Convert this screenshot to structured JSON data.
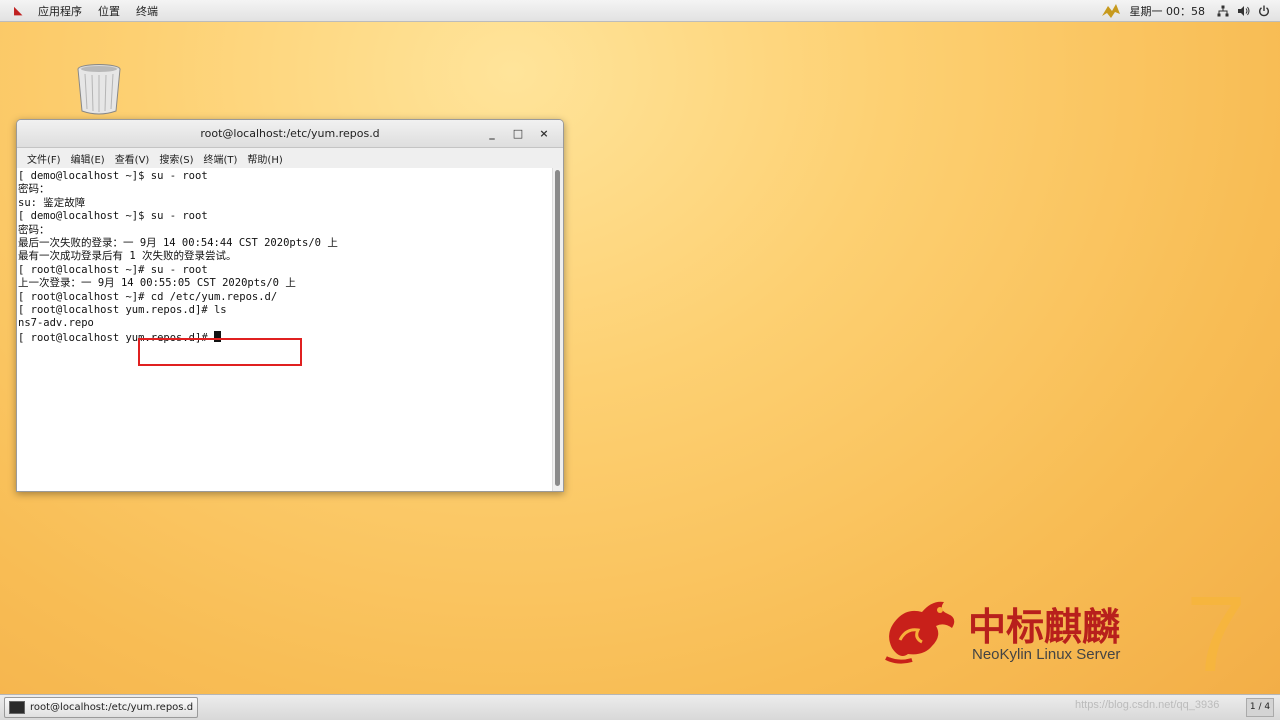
{
  "top_panel": {
    "menus": [
      "应用程序",
      "位置",
      "终端"
    ],
    "clock": "星期一 00：58",
    "tray_icons": [
      "network-icon",
      "volume-icon",
      "power-icon"
    ]
  },
  "desktop": {
    "trash_icon": "trash-icon"
  },
  "terminal": {
    "title": "root@localhost:/etc/yum.repos.d",
    "window_buttons": [
      "_",
      "□",
      "×"
    ],
    "menus": [
      "文件(F)",
      "编辑(E)",
      "查看(V)",
      "搜索(S)",
      "终端(T)",
      "帮助(H)"
    ],
    "lines": [
      "[ demo@localhost ~]$ su - root",
      "密码：",
      "su: 鉴定故障",
      "[ demo@localhost ~]$ su - root",
      "密码：",
      "最后一次失败的登录：一 9月 14 00:54:44 CST 2020pts/0 上",
      "最有一次成功登录后有 1 次失败的登录尝试。",
      "[ root@localhost ~]# su - root",
      "上一次登录：一 9月 14 00:55:05 CST 2020pts/0 上",
      "[ root@localhost ~]# cd /etc/yum.repos.d/",
      "[ root@localhost yum.repos.d]# ls",
      "ns7-adv.repo",
      "[ root@localhost yum.repos.d]# "
    ]
  },
  "logo": {
    "chinese": "中标麒麟",
    "english": "NeoKylin Linux Server",
    "version": "7"
  },
  "taskbar": {
    "task_label": "root@localhost:/etc/yum.repos.d",
    "watermark": "https://blog.csdn.net/qq_3936",
    "pager": "1 / 4"
  },
  "colors": {
    "highlight": "#e02020",
    "logo_red": "#b8201c",
    "accent_orange": "#f6b53e"
  }
}
